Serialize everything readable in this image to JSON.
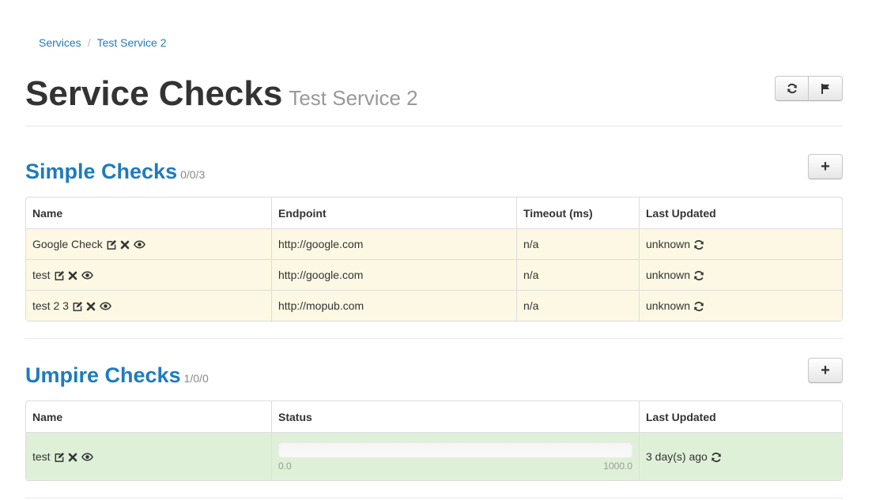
{
  "breadcrumb": {
    "items": [
      "Services",
      "Test Service 2"
    ],
    "separator": "/"
  },
  "header": {
    "title": "Service Checks",
    "subtitle": "Test Service 2",
    "buttons": [
      "refresh-icon",
      "flag-icon"
    ]
  },
  "simple_checks": {
    "title": "Simple Checks",
    "count": "0/0/3",
    "add_label": "+",
    "columns": [
      "Name",
      "Endpoint",
      "Timeout (ms)",
      "Last Updated"
    ],
    "rows": [
      {
        "name": "Google Check",
        "endpoint": "http://google.com",
        "timeout": "n/a",
        "updated": "unknown"
      },
      {
        "name": "test",
        "endpoint": "http://google.com",
        "timeout": "n/a",
        "updated": "unknown"
      },
      {
        "name": "test 2 3",
        "endpoint": "http://mopub.com",
        "timeout": "n/a",
        "updated": "unknown"
      }
    ]
  },
  "umpire_checks": {
    "title": "Umpire Checks",
    "count": "1/0/0",
    "add_label": "+",
    "columns": [
      "Name",
      "Status",
      "Last Updated"
    ],
    "rows": [
      {
        "name": "test",
        "status_min": "0.0",
        "status_max": "1000.0",
        "status_value": 0,
        "updated": "3 day(s) ago"
      }
    ]
  },
  "colors": {
    "link": "#1f7bbd",
    "warning_row": "#fcf8e3",
    "success_row": "#dff0d8",
    "muted": "#999999"
  }
}
